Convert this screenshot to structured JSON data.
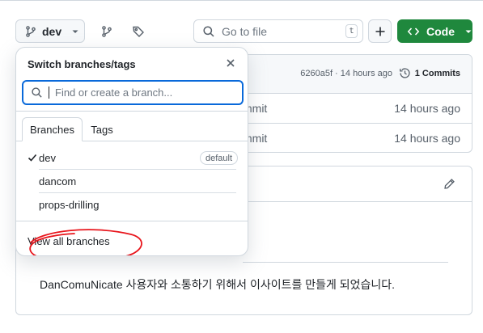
{
  "toolbar": {
    "branch_name": "dev",
    "goto_placeholder": "Go to file",
    "goto_shortcut": "t",
    "code_label": "Code"
  },
  "commit_box": {
    "sha_time": "6260a5f · 14 hours ago",
    "commits_label": "1 Commits",
    "rows": [
      {
        "msg": "mmit",
        "time": "14 hours ago"
      },
      {
        "msg": "mmit",
        "time": "14 hours ago"
      }
    ]
  },
  "readme": {
    "text": "DanComuNicate 사용자와 소통하기 위해서 이사이트를 만들게 되었습니다."
  },
  "dropdown": {
    "title": "Switch branches/tags",
    "search_placeholder": "Find or create a branch...",
    "tabs": {
      "branches": "Branches",
      "tags": "Tags"
    },
    "items": [
      {
        "label": "dev",
        "selected": true,
        "badge": "default"
      },
      {
        "label": "dancom"
      },
      {
        "label": "props-drilling"
      }
    ],
    "view_all": "View all branches"
  },
  "colors": {
    "accent_blue": "#0969da",
    "code_green": "#1f883d",
    "annotation_red": "#e8141b"
  }
}
